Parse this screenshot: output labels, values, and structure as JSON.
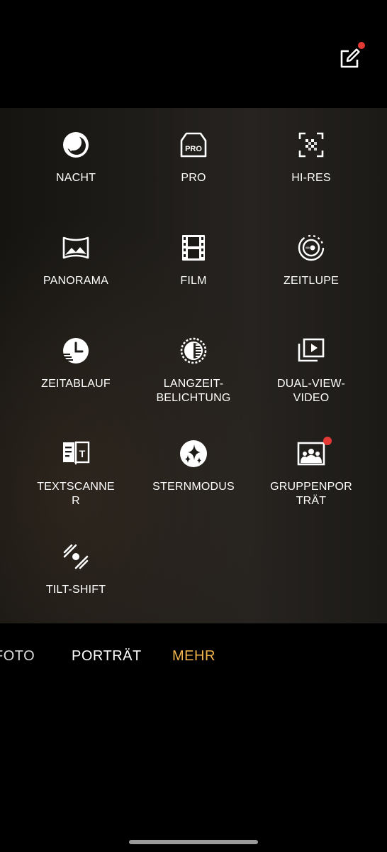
{
  "top_bar": {
    "edit_icon": "edit-square-icon",
    "notification_dot_color": "#e53935"
  },
  "modes": [
    {
      "id": "nacht",
      "label": "NACHT",
      "icon": "night-mode-icon"
    },
    {
      "id": "pro",
      "label": "PRO",
      "icon": "pro-camera-icon"
    },
    {
      "id": "hi-res",
      "label": "HI-RES",
      "icon": "hi-res-grid-icon"
    },
    {
      "id": "panorama",
      "label": "PANORAMA",
      "icon": "panorama-icon"
    },
    {
      "id": "film",
      "label": "FILM",
      "icon": "film-strip-icon"
    },
    {
      "id": "zeitlupe",
      "label": "ZEITLUPE",
      "icon": "slow-motion-icon"
    },
    {
      "id": "zeitablauf",
      "label": "ZEITABLAUF",
      "icon": "time-lapse-clock-icon"
    },
    {
      "id": "langzeitbelichtung",
      "label": "LANGZEIT-\nBELICHTUNG",
      "icon": "long-exposure-icon"
    },
    {
      "id": "dual-view-video",
      "label": "DUAL-VIEW-\nVIDEO",
      "icon": "dual-view-video-icon"
    },
    {
      "id": "textscanner",
      "label": "TEXTSCANNE\nR",
      "icon": "text-scanner-icon"
    },
    {
      "id": "sternmodus",
      "label": "STERNMODUS",
      "icon": "star-mode-icon"
    },
    {
      "id": "gruppenportraet",
      "label": "GRUPPENPOR\nTRÄT",
      "icon": "group-portrait-icon",
      "has_new_badge": true
    },
    {
      "id": "tilt-shift",
      "label": "TILT-SHIFT",
      "icon": "tilt-shift-icon"
    }
  ],
  "tabs": [
    {
      "label": "FOTO",
      "active": false
    },
    {
      "label": "PORTRÄT",
      "active": false
    },
    {
      "label": "MEHR",
      "active": true
    }
  ],
  "colors": {
    "active_tab": "#f0b44c",
    "inactive_tab": "#ffffff",
    "badge": "#e53935"
  }
}
